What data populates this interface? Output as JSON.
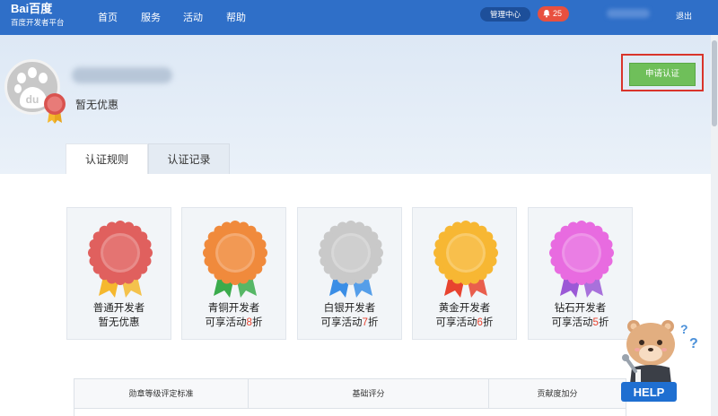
{
  "header": {
    "logo_text": "Bai百度",
    "logo_sub": "百度开发者平台",
    "nav": [
      "首页",
      "服务",
      "活动",
      "帮助"
    ],
    "manage_label": "管理中心",
    "notification_count": "25",
    "logout_label": "退出",
    "bar_color": "#2f6fc8"
  },
  "profile": {
    "avatar_glyph": "du",
    "status_text": "暂无优惠",
    "apply_button": "申请认证"
  },
  "tabs": [
    {
      "label": "认证规则",
      "active": true
    },
    {
      "label": "认证记录",
      "active": false
    }
  ],
  "medals": [
    {
      "title": "普通开发者",
      "sub_pre": "暂无优惠",
      "sub_num": "",
      "sub_post": "",
      "color": "#e0605e",
      "ribbon": "#f5b82e"
    },
    {
      "title": "青铜开发者",
      "sub_pre": "可享活动",
      "sub_num": "8",
      "sub_post": "折",
      "color": "#f08a3c",
      "ribbon": "#3bab4c"
    },
    {
      "title": "白银开发者",
      "sub_pre": "可享活动",
      "sub_num": "7",
      "sub_post": "折",
      "color": "#c9c9c9",
      "ribbon": "#3a8ee6"
    },
    {
      "title": "黄金开发者",
      "sub_pre": "可享活动",
      "sub_num": "6",
      "sub_post": "折",
      "color": "#f7b733",
      "ribbon": "#e8432f"
    },
    {
      "title": "钻石开发者",
      "sub_pre": "可享活动",
      "sub_num": "5",
      "sub_post": "折",
      "color": "#e86be0",
      "ribbon": "#9b59d6"
    }
  ],
  "table": {
    "headers": [
      "勋章等级评定标准",
      "基础评分",
      "贡献度加分"
    ]
  },
  "help": {
    "label": "HELP",
    "question_marks": "? ?"
  }
}
